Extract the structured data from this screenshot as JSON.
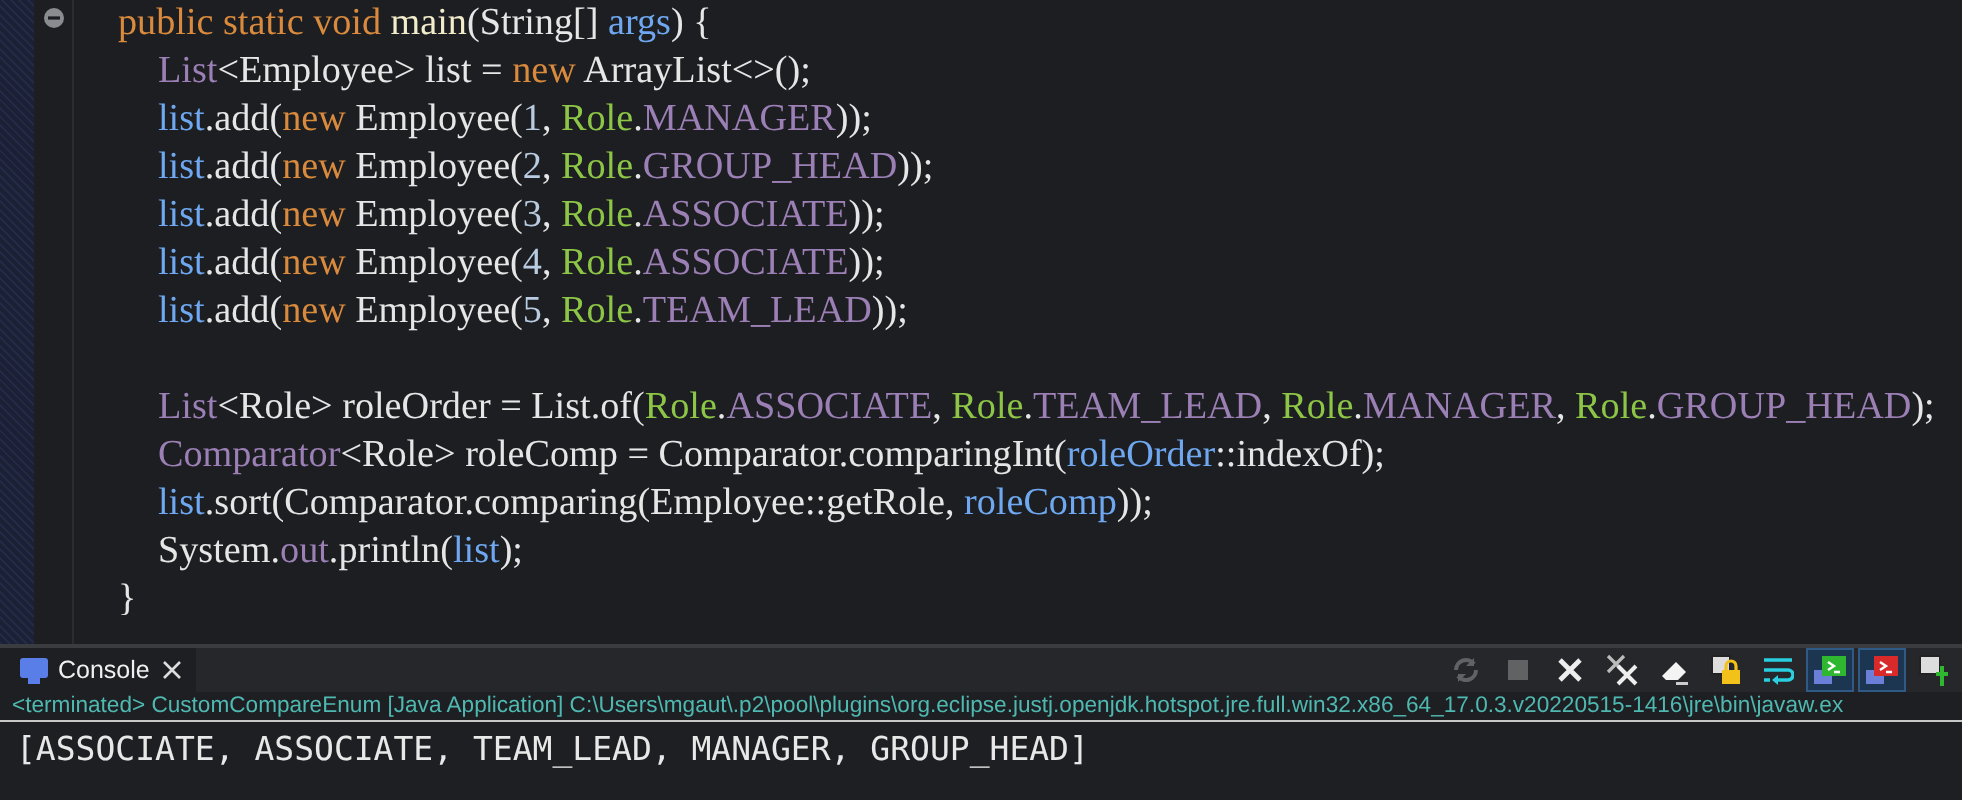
{
  "editor": {
    "method": {
      "expanded": true,
      "signature": [
        {
          "kind": "keyword",
          "text": "public static void "
        },
        {
          "kind": "method",
          "text": "main"
        },
        {
          "kind": "plain",
          "text": "(String[] "
        },
        {
          "kind": "variable",
          "text": "args"
        },
        {
          "kind": "plain",
          "text": ") {"
        }
      ],
      "body": [
        {
          "kind": "code",
          "tokens": [
            {
              "kind": "type",
              "text": "List"
            },
            {
              "kind": "plain",
              "text": "<Employee> list = "
            },
            {
              "kind": "keyword",
              "text": "new"
            },
            {
              "kind": "plain",
              "text": " ArrayList<>();"
            }
          ]
        },
        {
          "kind": "code",
          "tokens": [
            {
              "kind": "variable",
              "text": "list"
            },
            {
              "kind": "plain",
              "text": ".add("
            },
            {
              "kind": "keyword",
              "text": "new"
            },
            {
              "kind": "plain",
              "text": " Employee("
            },
            {
              "kind": "number",
              "text": "1"
            },
            {
              "kind": "plain",
              "text": ", "
            },
            {
              "kind": "class",
              "text": "Role"
            },
            {
              "kind": "plain",
              "text": "."
            },
            {
              "kind": "constant",
              "text": "MANAGER"
            },
            {
              "kind": "plain",
              "text": "));"
            }
          ]
        },
        {
          "kind": "code",
          "tokens": [
            {
              "kind": "variable",
              "text": "list"
            },
            {
              "kind": "plain",
              "text": ".add("
            },
            {
              "kind": "keyword",
              "text": "new"
            },
            {
              "kind": "plain",
              "text": " Employee("
            },
            {
              "kind": "number",
              "text": "2"
            },
            {
              "kind": "plain",
              "text": ", "
            },
            {
              "kind": "class",
              "text": "Role"
            },
            {
              "kind": "plain",
              "text": "."
            },
            {
              "kind": "constant",
              "text": "GROUP_HEAD"
            },
            {
              "kind": "plain",
              "text": "));"
            }
          ]
        },
        {
          "kind": "code",
          "tokens": [
            {
              "kind": "variable",
              "text": "list"
            },
            {
              "kind": "plain",
              "text": ".add("
            },
            {
              "kind": "keyword",
              "text": "new"
            },
            {
              "kind": "plain",
              "text": " Employee("
            },
            {
              "kind": "number",
              "text": "3"
            },
            {
              "kind": "plain",
              "text": ", "
            },
            {
              "kind": "class",
              "text": "Role"
            },
            {
              "kind": "plain",
              "text": "."
            },
            {
              "kind": "constant",
              "text": "ASSOCIATE"
            },
            {
              "kind": "plain",
              "text": "));"
            }
          ]
        },
        {
          "kind": "code",
          "tokens": [
            {
              "kind": "variable",
              "text": "list"
            },
            {
              "kind": "plain",
              "text": ".add("
            },
            {
              "kind": "keyword",
              "text": "new"
            },
            {
              "kind": "plain",
              "text": " Employee("
            },
            {
              "kind": "number",
              "text": "4"
            },
            {
              "kind": "plain",
              "text": ", "
            },
            {
              "kind": "class",
              "text": "Role"
            },
            {
              "kind": "plain",
              "text": "."
            },
            {
              "kind": "constant",
              "text": "ASSOCIATE"
            },
            {
              "kind": "plain",
              "text": "));"
            }
          ]
        },
        {
          "kind": "code",
          "tokens": [
            {
              "kind": "variable",
              "text": "list"
            },
            {
              "kind": "plain",
              "text": ".add("
            },
            {
              "kind": "keyword",
              "text": "new"
            },
            {
              "kind": "plain",
              "text": " Employee("
            },
            {
              "kind": "number",
              "text": "5"
            },
            {
              "kind": "plain",
              "text": ", "
            },
            {
              "kind": "class",
              "text": "Role"
            },
            {
              "kind": "plain",
              "text": "."
            },
            {
              "kind": "constant",
              "text": "TEAM_LEAD"
            },
            {
              "kind": "plain",
              "text": "));"
            }
          ]
        },
        {
          "kind": "blank"
        },
        {
          "kind": "code",
          "tokens": [
            {
              "kind": "type",
              "text": "List"
            },
            {
              "kind": "plain",
              "text": "<Role> roleOrder = List.of("
            },
            {
              "kind": "class",
              "text": "Role"
            },
            {
              "kind": "plain",
              "text": "."
            },
            {
              "kind": "constant",
              "text": "ASSOCIATE"
            },
            {
              "kind": "plain",
              "text": ", "
            },
            {
              "kind": "class",
              "text": "Role"
            },
            {
              "kind": "plain",
              "text": "."
            },
            {
              "kind": "constant",
              "text": "TEAM_LEAD"
            },
            {
              "kind": "plain",
              "text": ", "
            },
            {
              "kind": "class",
              "text": "Role"
            },
            {
              "kind": "plain",
              "text": "."
            },
            {
              "kind": "constant",
              "text": "MANAGER"
            },
            {
              "kind": "plain",
              "text": ", "
            },
            {
              "kind": "class",
              "text": "Role"
            },
            {
              "kind": "plain",
              "text": "."
            },
            {
              "kind": "constant",
              "text": "GROUP_HEAD"
            },
            {
              "kind": "plain",
              "text": ");"
            }
          ]
        },
        {
          "kind": "code",
          "tokens": [
            {
              "kind": "type",
              "text": "Comparator"
            },
            {
              "kind": "plain",
              "text": "<Role> roleComp = Comparator.comparingInt("
            },
            {
              "kind": "variable",
              "text": "roleOrder"
            },
            {
              "kind": "plain",
              "text": "::indexOf);"
            }
          ]
        },
        {
          "kind": "code",
          "tokens": [
            {
              "kind": "variable",
              "text": "list"
            },
            {
              "kind": "plain",
              "text": ".sort(Comparator.comparing(Employee::getRole, "
            },
            {
              "kind": "variable",
              "text": "roleComp"
            },
            {
              "kind": "plain",
              "text": "));"
            }
          ]
        },
        {
          "kind": "code",
          "tokens": [
            {
              "kind": "plain",
              "text": "System."
            },
            {
              "kind": "constant",
              "text": "out"
            },
            {
              "kind": "plain",
              "text": ".println("
            },
            {
              "kind": "variable",
              "text": "list"
            },
            {
              "kind": "plain",
              "text": ");"
            }
          ]
        }
      ],
      "close": [
        {
          "kind": "plain",
          "text": "}"
        }
      ]
    }
  },
  "console": {
    "tab": {
      "label": "Console",
      "selected": true
    },
    "toolbar": [
      {
        "kind": "refresh",
        "disabled": true,
        "on": false
      },
      {
        "kind": "stop",
        "disabled": true,
        "on": false
      },
      {
        "kind": "remove",
        "disabled": false,
        "on": false
      },
      {
        "kind": "remove-all",
        "disabled": false,
        "on": false
      },
      {
        "kind": "clear",
        "disabled": false,
        "on": false
      },
      {
        "kind": "scroll-lock",
        "disabled": false,
        "on": false
      },
      {
        "kind": "word-wrap",
        "disabled": false,
        "on": false
      },
      {
        "kind": "stdout",
        "disabled": false,
        "on": true
      },
      {
        "kind": "stderr",
        "disabled": false,
        "on": true
      },
      {
        "kind": "pin",
        "disabled": false,
        "on": false
      }
    ],
    "status": "<terminated> CustomCompareEnum [Java Application] C:\\Users\\mgaut\\.p2\\pool\\plugins\\org.eclipse.justj.openjdk.hotspot.jre.full.win32.x86_64_17.0.3.v20220515-1416\\jre\\bin\\javaw.ex",
    "output": "[ASSOCIATE, ASSOCIATE, TEAM_LEAD, MANAGER, GROUP_HEAD]"
  }
}
